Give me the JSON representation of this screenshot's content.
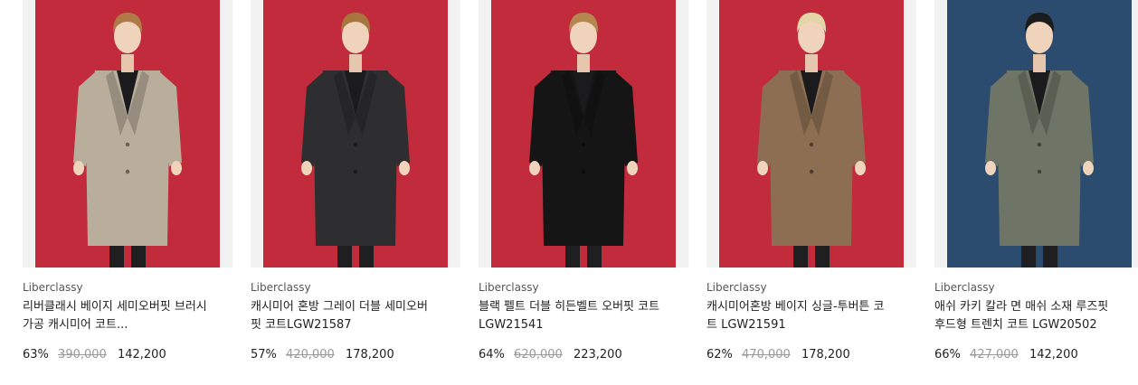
{
  "products": [
    {
      "brand": "Liberclassy",
      "name": "리버클래시 베이지 세미오버핏 브러시가공 캐시미어 코트...",
      "discount": "63%",
      "original_price": "390,000",
      "sale_price": "142,200",
      "photo": {
        "backdrop": "#c22b3b",
        "coat": "#b9ad9c",
        "hair": "#b07a48",
        "icon": "model-beige-coat-icon"
      }
    },
    {
      "brand": "Liberclassy",
      "name": "캐시미어 혼방 그레이 더블 세미오버핏 코트LGW21587",
      "discount": "57%",
      "original_price": "420,000",
      "sale_price": "178,200",
      "photo": {
        "backdrop": "#c22b3b",
        "coat": "#2e2e30",
        "hair": "#a9753e",
        "icon": "model-grey-coat-icon"
      }
    },
    {
      "brand": "Liberclassy",
      "name": "블랙 펠트 더블 히든벨트 오버핏 코트LGW21541",
      "discount": "64%",
      "original_price": "620,000",
      "sale_price": "223,200",
      "photo": {
        "backdrop": "#c22b3b",
        "coat": "#151515",
        "hair": "#b58750",
        "icon": "model-black-coat-icon"
      }
    },
    {
      "brand": "Liberclassy",
      "name": "캐시미어혼방 베이지 싱글-투버튼 코트 LGW21591",
      "discount": "62%",
      "original_price": "470,000",
      "sale_price": "178,200",
      "photo": {
        "backdrop": "#c22b3b",
        "coat": "#8d6e52",
        "hair": "#e3d5a6",
        "icon": "model-camel-coat-icon"
      }
    },
    {
      "brand": "Liberclassy",
      "name": "애쉬 카키 칼라 면 매쉬 소재 루즈핏 후드형 트렌치 코트 LGW20502",
      "discount": "66%",
      "original_price": "427,000",
      "sale_price": "142,200",
      "photo": {
        "backdrop": "#2b4c6e",
        "coat": "#6f7566",
        "hair": "#1c1c1c",
        "icon": "model-khaki-trench-icon"
      }
    }
  ]
}
